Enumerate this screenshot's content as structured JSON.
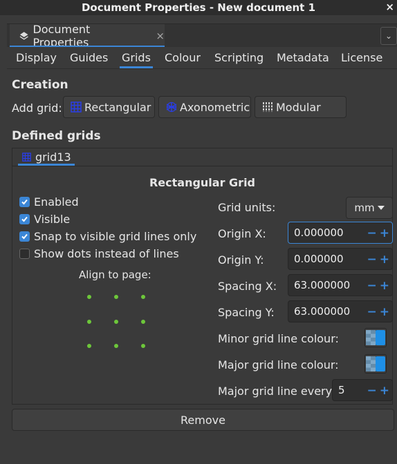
{
  "window": {
    "title": "Document Properties - New document 1",
    "close": "×"
  },
  "dock": {
    "tab_label": "Document Properties",
    "tab_close": "×",
    "menu_glyph": "⌄"
  },
  "tabs": [
    "Display",
    "Guides",
    "Grids",
    "Colour",
    "Scripting",
    "Metadata",
    "License"
  ],
  "active_tab": "Grids",
  "creation": {
    "title": "Creation",
    "add_grid_label": "Add grid:",
    "buttons": [
      "Rectangular",
      "Axonometric",
      "Modular"
    ]
  },
  "defined": {
    "title": "Defined grids",
    "grid_tab": "grid13",
    "heading": "Rectangular Grid",
    "checkboxes": [
      {
        "label": "Enabled",
        "checked": true
      },
      {
        "label": "Visible",
        "checked": true
      },
      {
        "label": "Snap to visible grid lines only",
        "checked": true
      },
      {
        "label": "Show dots instead of lines",
        "checked": false
      }
    ],
    "align_label": "Align to page:",
    "units_label": "Grid units:",
    "units_value": "mm",
    "origin_x_label": "Origin X:",
    "origin_x": "0.000000",
    "origin_y_label": "Origin Y:",
    "origin_y": "0.000000",
    "spacing_x_label": "Spacing X:",
    "spacing_x": "63.000000",
    "spacing_y_label": "Spacing Y:",
    "spacing_y": "63.000000",
    "minor_label": "Minor grid line colour:",
    "major_label": "Major grid line colour:",
    "major_every_label": "Major grid line every:",
    "major_every": "5",
    "minor_colour": "#1e8fe6",
    "major_colour": "#1e8fe6"
  },
  "remove_label": "Remove",
  "colors": {
    "accent": "#3b86d6",
    "anchor": "#6dc73a",
    "background": "#3a3a3a"
  }
}
